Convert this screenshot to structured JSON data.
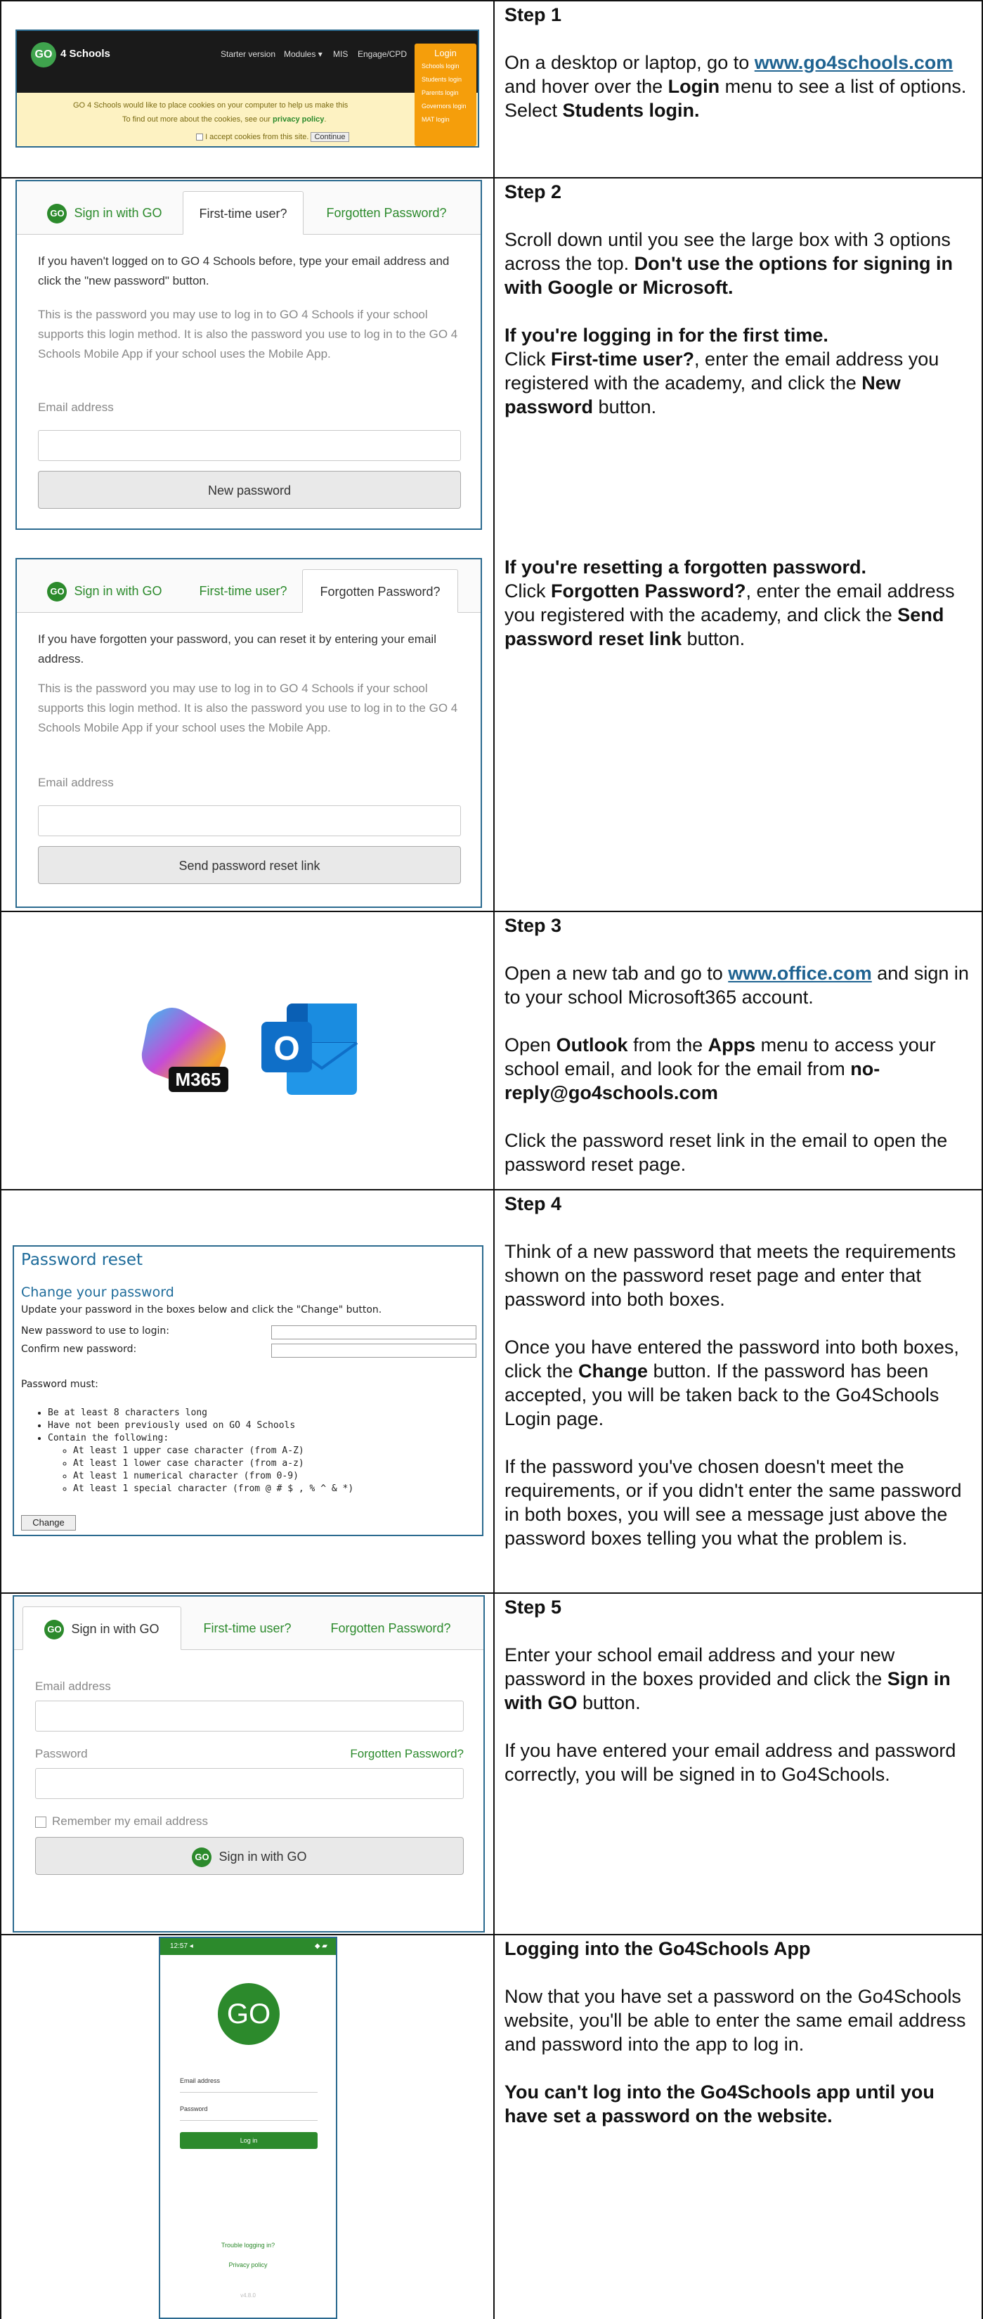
{
  "step1": {
    "heading": "Step 1",
    "text_a": "On a desktop or laptop, go to ",
    "link": "www.go4schools.com",
    "text_b": " and hover over the ",
    "text_login": "Login",
    "text_c": " menu to see a list of options.",
    "text_d": "Select ",
    "text_students": "Students login.",
    "shot": {
      "logo_text": "4 Schools",
      "logo_badge": "GO",
      "nav": [
        "Starter version",
        "Modules ▾",
        "MIS",
        "Engage/CPD"
      ],
      "login_label": "Login",
      "login_menu": [
        "Schools login",
        "Students login",
        "Parents login",
        "Governors login",
        "MAT login"
      ],
      "cookie_line1": "GO 4 Schools would like to place cookies on your computer to help us make this",
      "cookie_line2a": "To find out more about the cookies, see our ",
      "cookie_line2b": "privacy policy",
      "cookie_accept": "I accept cookies from this site.",
      "cookie_continue": "Continue"
    }
  },
  "step2": {
    "heading": "Step 2",
    "intro_a": "Scroll down until you see the large box with 3 options across the top. ",
    "intro_b": "Don't use the options for signing in with Google or Microsoft.",
    "first_heading": "If you're logging in for the first time.",
    "first_a": "Click ",
    "first_b": "First-time user?",
    "first_c": ", enter the email address you registered with the academy, and click the ",
    "first_d": "New password",
    "first_e": " button.",
    "reset_heading": "If you're resetting a forgotten password.",
    "reset_a": "Click ",
    "reset_b": "Forgotten Password?",
    "reset_c": ", enter the email address you registered with the academy, and click the ",
    "reset_d": "Send password reset link",
    "reset_e": " button.",
    "tabs": [
      "Sign in with GO",
      "First-time user?",
      "Forgotten Password?"
    ],
    "badge": "GO",
    "shot_a": {
      "text1": "If you haven't logged on to GO 4 Schools before, type your email address and click the \"new password\" button.",
      "text2": "This is the password you may use to log in to GO 4 Schools if your school supports this login method. It is also the password you use to log in to the GO 4 Schools Mobile App if your school uses the Mobile App.",
      "email_label": "Email address",
      "button": "New password"
    },
    "shot_b": {
      "text1": "If you have forgotten your password, you can reset it by entering your email address.",
      "text2": "This is the password you may use to log in to GO 4 Schools if your school supports this login method. It is also the password you use to log in to the GO 4 Schools Mobile App if your school uses the Mobile App.",
      "email_label": "Email address",
      "button": "Send password reset link"
    }
  },
  "step3": {
    "heading": "Step 3",
    "p1_a": "Open a new tab and go to ",
    "p1_link": "www.office.com",
    "p1_b": " and sign in to your school Microsoft365 account.",
    "p2_a": "Open ",
    "p2_b": "Outlook",
    "p2_c": " from the ",
    "p2_d": "Apps",
    "p2_e": " menu to access your school email, and look for the email from ",
    "p2_f": "no-reply@go4schools.com",
    "p3": "Click the password reset link in the email to open the password reset page.",
    "m365_label": "M365",
    "outlook_letter": "O"
  },
  "step4": {
    "heading": "Step 4",
    "p1": "Think of a new password that meets the requirements shown on the password reset page and enter that password into both boxes.",
    "p2_a": "Once you have entered the password into both boxes, click the ",
    "p2_b": "Change",
    "p2_c": " button. If the password has been accepted, you will be taken back to the Go4Schools Login page.",
    "p3": "If the password you've chosen doesn't meet the requirements, or if you didn't enter the same password in both boxes, you will see a message just above the password boxes telling you what the problem is.",
    "shot": {
      "title": "Password reset",
      "subtitle": "Change your password",
      "instruction": "Update your password in the boxes below and click the \"Change\" button.",
      "new_label": "New password to use to login:",
      "confirm_label": "Confirm new password:",
      "must": "Password must:",
      "rules": [
        "Be at least 8 characters long",
        "Have not been previously used on GO 4 Schools",
        "Contain the following:"
      ],
      "subrules": [
        "At least 1 upper case character (from A-Z)",
        "At least 1 lower case character (from a-z)",
        "At least 1 numerical character (from 0-9)",
        "At least 1 special character (from @ # $ , % ^ & *)"
      ],
      "button": "Change"
    }
  },
  "step5": {
    "heading": "Step 5",
    "p1_a": "Enter your school email address and your new password in the boxes provided and click the ",
    "p1_b": "Sign in with GO",
    "p1_c": " button.",
    "p2": "If you have entered your email address and password correctly, you will be signed in to Go4Schools.",
    "shot": {
      "email_label": "Email address",
      "password_label": "Password",
      "forgot": "Forgotten Password?",
      "remember": "Remember my email address",
      "button": "Sign in with GO"
    }
  },
  "app": {
    "heading": "Logging into the Go4Schools App",
    "p1": "Now that you have set a password on the Go4Schools website, you'll be able to enter the same email address and password into the app to log in.",
    "p2": "You can't log into the Go4Schools app until you have set a password on the website.",
    "phone": {
      "time": "12:57 ◂",
      "status_icons": "◆ ▰",
      "logo": "GO",
      "email_label": "Email address",
      "password_label": "Password",
      "button": "Log in",
      "trouble": "Trouble logging in?",
      "privacy": "Privacy policy",
      "version": "v4.8.0"
    }
  }
}
